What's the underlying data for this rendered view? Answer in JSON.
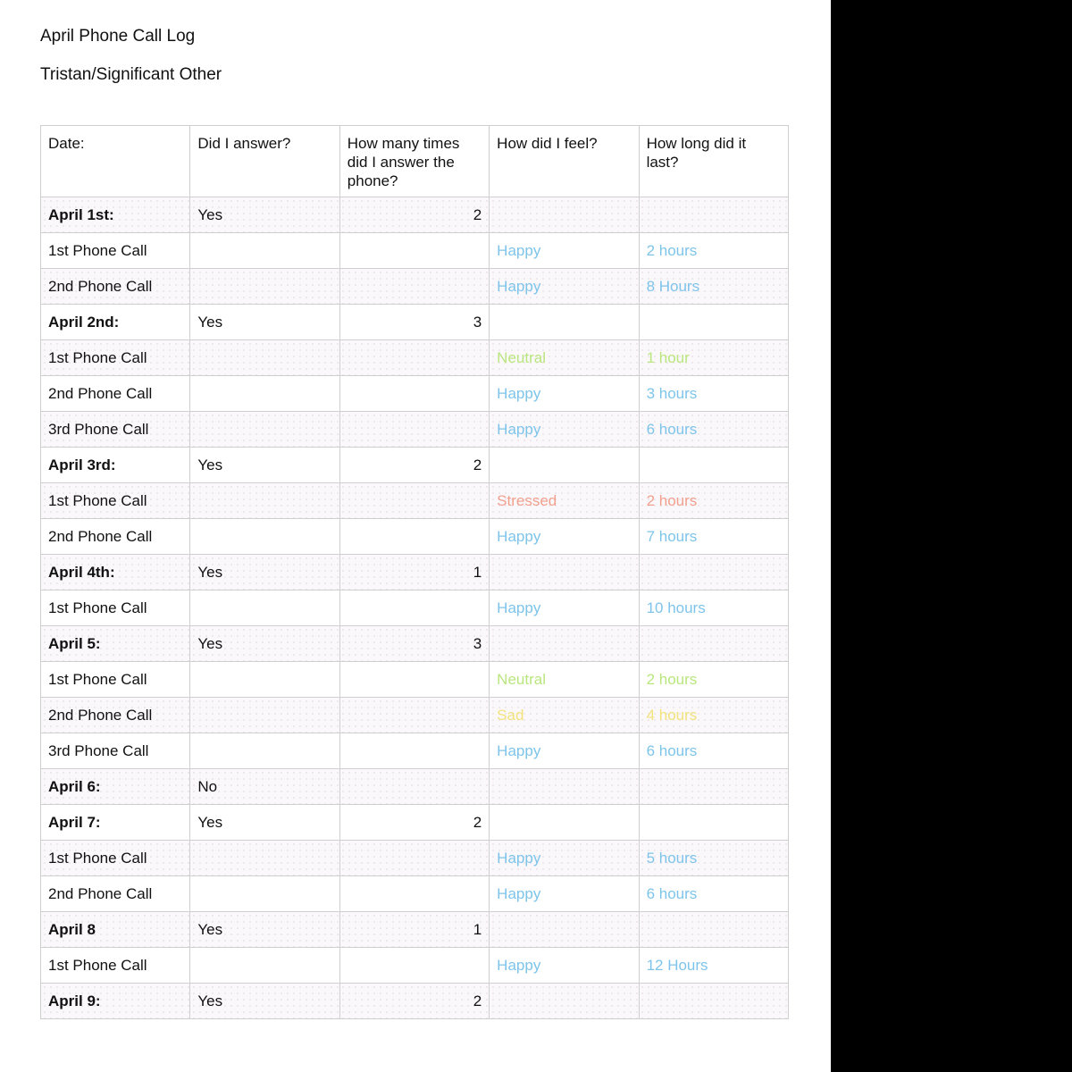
{
  "title": "April Phone Call Log",
  "subtitle": "Tristan/Significant Other",
  "colors": {
    "happy": "#7ec4ea",
    "neutral": "#b9e67e",
    "stressed": "#f1a08e",
    "sad": "#f2e27c"
  },
  "table": {
    "headers": [
      "Date:",
      "Did I answer?",
      "How many times did I answer the phone?",
      "How did I feel?",
      "How long did it last?"
    ],
    "rows": [
      {
        "label": "April 1st:",
        "bold": true,
        "answered": "Yes",
        "count": "2",
        "feeling": "",
        "duration": ""
      },
      {
        "label": "1st Phone Call",
        "bold": false,
        "answered": "",
        "count": "",
        "feeling": "Happy",
        "duration": "2 hours",
        "mood": "happy"
      },
      {
        "label": "2nd Phone Call",
        "bold": false,
        "answered": "",
        "count": "",
        "feeling": "Happy",
        "duration": "8 Hours",
        "mood": "happy"
      },
      {
        "label": "April 2nd:",
        "bold": true,
        "answered": "Yes",
        "count": "3",
        "feeling": "",
        "duration": ""
      },
      {
        "label": "1st Phone Call",
        "bold": false,
        "answered": "",
        "count": "",
        "feeling": "Neutral",
        "duration": "1 hour",
        "mood": "neutral"
      },
      {
        "label": "2nd Phone Call",
        "bold": false,
        "answered": "",
        "count": "",
        "feeling": "Happy",
        "duration": "3 hours",
        "mood": "happy"
      },
      {
        "label": "3rd Phone Call",
        "bold": false,
        "answered": "",
        "count": "",
        "feeling": "Happy",
        "duration": "6 hours",
        "mood": "happy"
      },
      {
        "label": "April 3rd:",
        "bold": true,
        "answered": "Yes",
        "count": "2",
        "feeling": "",
        "duration": ""
      },
      {
        "label": "1st Phone Call",
        "bold": false,
        "answered": "",
        "count": "",
        "feeling": "Stressed",
        "duration": "2 hours",
        "mood": "stressed"
      },
      {
        "label": "2nd Phone Call",
        "bold": false,
        "answered": "",
        "count": "",
        "feeling": "Happy",
        "duration": "7 hours",
        "mood": "happy"
      },
      {
        "label": "April 4th:",
        "bold": true,
        "answered": "Yes",
        "count": "1",
        "feeling": "",
        "duration": ""
      },
      {
        "label": "1st Phone Call",
        "bold": false,
        "answered": "",
        "count": "",
        "feeling": "Happy",
        "duration": "10 hours",
        "mood": "happy"
      },
      {
        "label": "April 5:",
        "bold": true,
        "answered": "Yes",
        "count": "3",
        "feeling": "",
        "duration": ""
      },
      {
        "label": "1st Phone Call",
        "bold": false,
        "answered": "",
        "count": "",
        "feeling": "Neutral",
        "duration": "2 hours",
        "mood": "neutral"
      },
      {
        "label": "2nd Phone Call",
        "bold": false,
        "answered": "",
        "count": "",
        "feeling": "Sad",
        "duration": "4 hours",
        "mood": "sad"
      },
      {
        "label": "3rd Phone Call",
        "bold": false,
        "answered": "",
        "count": "",
        "feeling": "Happy",
        "duration": "6 hours",
        "mood": "happy"
      },
      {
        "label": "April 6:",
        "bold": true,
        "answered": "No",
        "count": "",
        "feeling": "",
        "duration": ""
      },
      {
        "label": "April 7:",
        "bold": true,
        "answered": "Yes",
        "count": "2",
        "feeling": "",
        "duration": ""
      },
      {
        "label": "1st Phone Call",
        "bold": false,
        "answered": "",
        "count": "",
        "feeling": "Happy",
        "duration": "5 hours",
        "mood": "happy"
      },
      {
        "label": "2nd Phone Call",
        "bold": false,
        "answered": "",
        "count": "",
        "feeling": "Happy",
        "duration": "6 hours",
        "mood": "happy"
      },
      {
        "label": "April 8",
        "bold": true,
        "answered": "Yes",
        "count": "1",
        "feeling": "",
        "duration": ""
      },
      {
        "label": "1st Phone Call",
        "bold": false,
        "answered": "",
        "count": "",
        "feeling": "Happy",
        "duration": "12 Hours",
        "mood": "happy"
      },
      {
        "label": "April 9:",
        "bold": true,
        "answered": "Yes",
        "count": "2",
        "feeling": "",
        "duration": ""
      }
    ]
  }
}
